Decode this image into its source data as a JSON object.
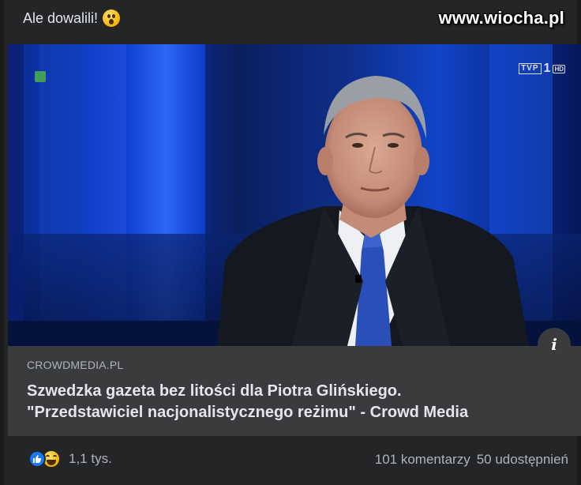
{
  "post": {
    "text": "Ale dowalili!",
    "emoji": "astonished-face-icon"
  },
  "watermark": "www.wiocha.pl",
  "image": {
    "channel_logo_box": "TVP",
    "channel_logo_num": "1",
    "channel_logo_hd": "HD",
    "info_label": "i"
  },
  "link": {
    "domain": "CROWDMEDIA.PL",
    "title_line1": "Szwedzka gazeta bez litości dla Piotra Glińskiego.",
    "title_line2": "\"Przedstawiciel nacjonalistycznego reżimu\" - Crowd Media"
  },
  "footer": {
    "reaction_count": "1,1 tys.",
    "comments": "101 komentarzy",
    "shares": "50 udostępnień"
  },
  "colors": {
    "background": "#242526",
    "link_box": "#3a3b3c",
    "like_blue": "#1877f2",
    "text_primary": "#e4e6eb",
    "text_secondary": "#b0b3b8"
  }
}
